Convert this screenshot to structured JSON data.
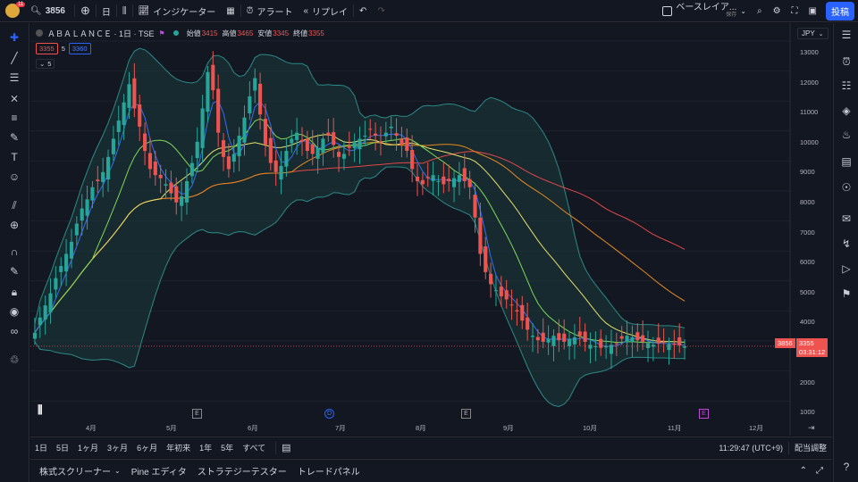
{
  "topbar": {
    "notification_count": "11",
    "symbol": "3856",
    "interval": "日",
    "indicators": "インジケーター",
    "alert": "アラート",
    "replay": "リプレイ",
    "layout_name": "ベースレイア...",
    "layout_status": "保存",
    "publish": "投稿"
  },
  "legend": {
    "name": "ＡＢＡＬＡＮＣＥ · 1日 · TSE",
    "open_label": "始値",
    "open": "3415",
    "high_label": "高値",
    "high": "3465",
    "low_label": "安値",
    "low": "3345",
    "close_label": "終値",
    "close": "3355",
    "bid": "3355",
    "qty": "5",
    "ask": "3360",
    "indicator_count": "5"
  },
  "axes": {
    "currency": "JPY",
    "y_labels": [
      "13000",
      "12000",
      "11000",
      "10000",
      "9000",
      "8000",
      "7000",
      "6000",
      "5000",
      "4000",
      "3000",
      "2000",
      "1000"
    ],
    "x_labels": [
      "4月",
      "5月",
      "6月",
      "7月",
      "8月",
      "9月",
      "10月",
      "11月",
      "12月"
    ],
    "last_price_left": "3856",
    "last_price": "3355",
    "countdown": "03:31:12",
    "event_markers": [
      "E",
      "D",
      "E",
      "E"
    ]
  },
  "bottombar": {
    "ranges": [
      "1日",
      "5日",
      "1ヶ月",
      "3ヶ月",
      "6ヶ月",
      "年初来",
      "1年",
      "5年",
      "すべて"
    ],
    "clock": "11:29:47 (UTC+9)",
    "adjust": "配当調整"
  },
  "panels": {
    "tabs": [
      "株式スクリーナー",
      "Pine エディタ",
      "ストラテジーテスター",
      "トレードパネル"
    ]
  },
  "colors": {
    "bg": "#131722",
    "up": "#26a69a",
    "down": "#ef5350",
    "accent": "#2962ff",
    "bb_fill": "#1b3b3d"
  },
  "chart_data": {
    "type": "candlestick",
    "x_range": [
      "3月",
      "12月"
    ],
    "ylim": [
      700,
      13600
    ],
    "closes": [
      3800,
      4300,
      4700,
      5100,
      5600,
      6000,
      6400,
      6800,
      7400,
      7900,
      8200,
      8600,
      8800,
      9100,
      9600,
      10200,
      10800,
      11400,
      12000,
      11200,
      10600,
      9800,
      9200,
      9000,
      8900,
      8700,
      8400,
      8100,
      8300,
      8800,
      9400,
      10100,
      11200,
      12400,
      11800,
      10400,
      9600,
      9200,
      9700,
      10300,
      10900,
      11600,
      12200,
      11000,
      10000,
      9400,
      9100,
      9300,
      9800,
      10200,
      10400,
      10100,
      9800,
      9700,
      9900,
      10200,
      10300,
      10000,
      9600,
      9700,
      9900,
      10100,
      10200,
      10300,
      10500,
      10300,
      10100,
      10400,
      10600,
      10300,
      10000,
      9800,
      9200,
      8800,
      8700,
      8900,
      9000,
      8800,
      8700,
      8800,
      8900,
      9000,
      8800,
      8600,
      7600,
      6400,
      5800,
      5400,
      5200,
      5000,
      4900,
      4700,
      4500,
      4200,
      3900,
      3700,
      3550,
      3500,
      3600,
      3700,
      3550,
      3500,
      3600,
      3650,
      3700,
      3500,
      3400,
      3350,
      3300,
      3350,
      3400,
      3450,
      3600,
      3700,
      3650,
      3550,
      3500,
      3450,
      3400,
      3450,
      3480,
      3420,
      3400,
      3380,
      3355
    ],
    "bollinger_upper": "approx",
    "moving_averages": [
      "blue",
      "yellow",
      "green",
      "orange",
      "red"
    ]
  }
}
